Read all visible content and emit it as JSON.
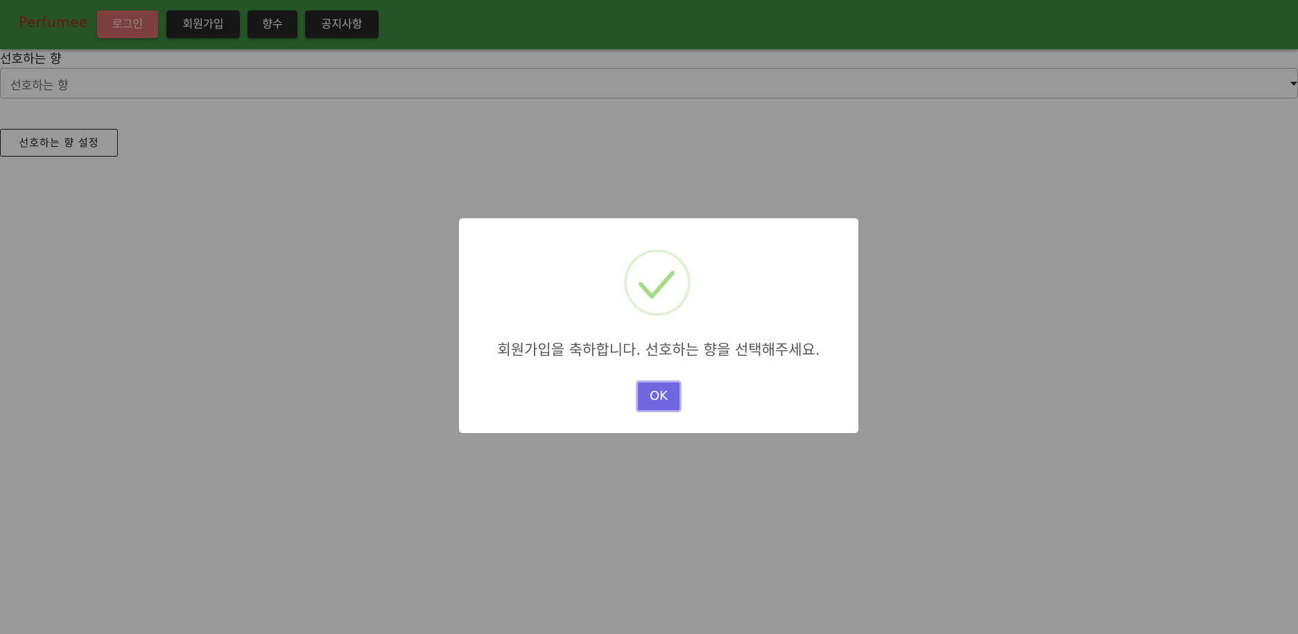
{
  "navbar": {
    "brand": "Perfumee",
    "buttons": {
      "login": "로그인",
      "signup": "회원가입",
      "perfume": "향수",
      "notice": "공지사항"
    }
  },
  "form": {
    "label": "선호하는 향",
    "select": {
      "placeholder": "선호하는 향"
    },
    "submit_label": "선호하는 향 설정"
  },
  "modal": {
    "icon": "success-check-icon",
    "message": "회원가입을 축하합니다. 선호하는 향을 선택해주세요.",
    "ok_label": "OK"
  },
  "colors": {
    "navbar": "#3e8e41",
    "brand": "#b5261e",
    "login_button": "#d16a6a",
    "nav_button": "#262626",
    "success_check": "#a5dc86",
    "confirm_button": "#7066e0"
  }
}
